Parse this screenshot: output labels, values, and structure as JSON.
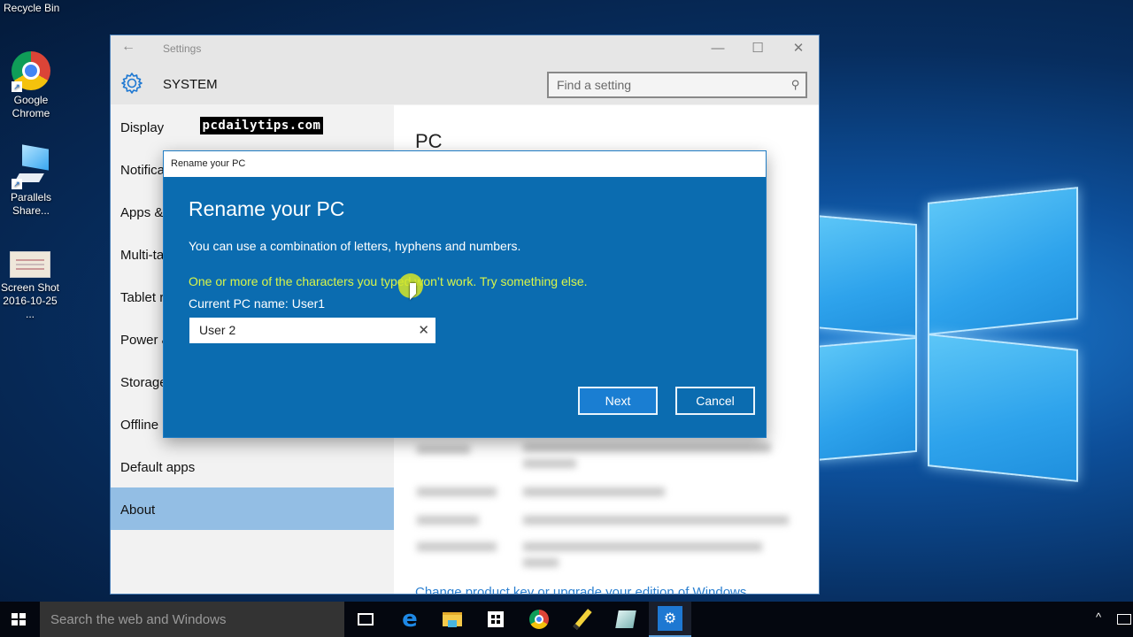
{
  "desktop": {
    "icons": [
      {
        "label": "Recycle Bin",
        "icon": "recycle-bin-icon"
      },
      {
        "label": "Google Chrome",
        "icon": "chrome-icon"
      },
      {
        "label": "Parallels Share...",
        "icon": "parallels-shared-folder-icon"
      },
      {
        "label": "Screen Shot 2016-10-25 ...",
        "icon": "image-file-icon"
      }
    ],
    "chrome_line1": "Google",
    "chrome_line2": "Chrome",
    "parallels_line1": "Parallels",
    "parallels_line2": "Share...",
    "screenshot_line1": "Screen Shot",
    "screenshot_line2": "2016-10-25 ..."
  },
  "settings": {
    "title": "Settings",
    "back_glyph": "←",
    "section": "SYSTEM",
    "search": {
      "placeholder": "Find a setting",
      "value": ""
    },
    "window_controls": {
      "minimize": "—",
      "maximize": "☐",
      "close": "✕"
    },
    "nav": [
      {
        "label": "Display",
        "active": false
      },
      {
        "label": "Notifica",
        "active": false
      },
      {
        "label": "Apps &",
        "active": false
      },
      {
        "label": "Multi-ta",
        "active": false
      },
      {
        "label": "Tablet r",
        "active": false
      },
      {
        "label": "Power &",
        "active": false
      },
      {
        "label": "Storage",
        "active": false
      },
      {
        "label": "Offline",
        "active": false
      },
      {
        "label": "Default apps",
        "active": false
      },
      {
        "label": "About",
        "active": true
      }
    ],
    "content": {
      "title": "PC",
      "product_link": "Change product key or upgrade your edition of Windows"
    }
  },
  "watermark": "pcdailytips.com",
  "dialog": {
    "window_title": "Rename your PC",
    "heading": "Rename your PC",
    "description": "You can use a combination of letters, hyphens and numbers.",
    "error": "One or more of the characters you typed won’t work. Try something else.",
    "current_name": "Current PC name: User1",
    "name_input": {
      "value": "User 2"
    },
    "clear_glyph": "✕",
    "next_label": "Next",
    "cancel_label": "Cancel"
  },
  "taskbar": {
    "search_placeholder": "Search the web and Windows",
    "apps": [
      "task-view",
      "edge",
      "file-explorer",
      "store",
      "chrome",
      "pencil",
      "notepad",
      "settings"
    ],
    "active_app": "settings",
    "tray_chevron": "^",
    "edge_glyph": "e",
    "settings_glyph": "⚙"
  },
  "colors": {
    "dialog_bg": "#0b6cb0",
    "error_text": "#d8f54a",
    "nav_active": "#93bee4",
    "accent": "#1e78d2"
  }
}
